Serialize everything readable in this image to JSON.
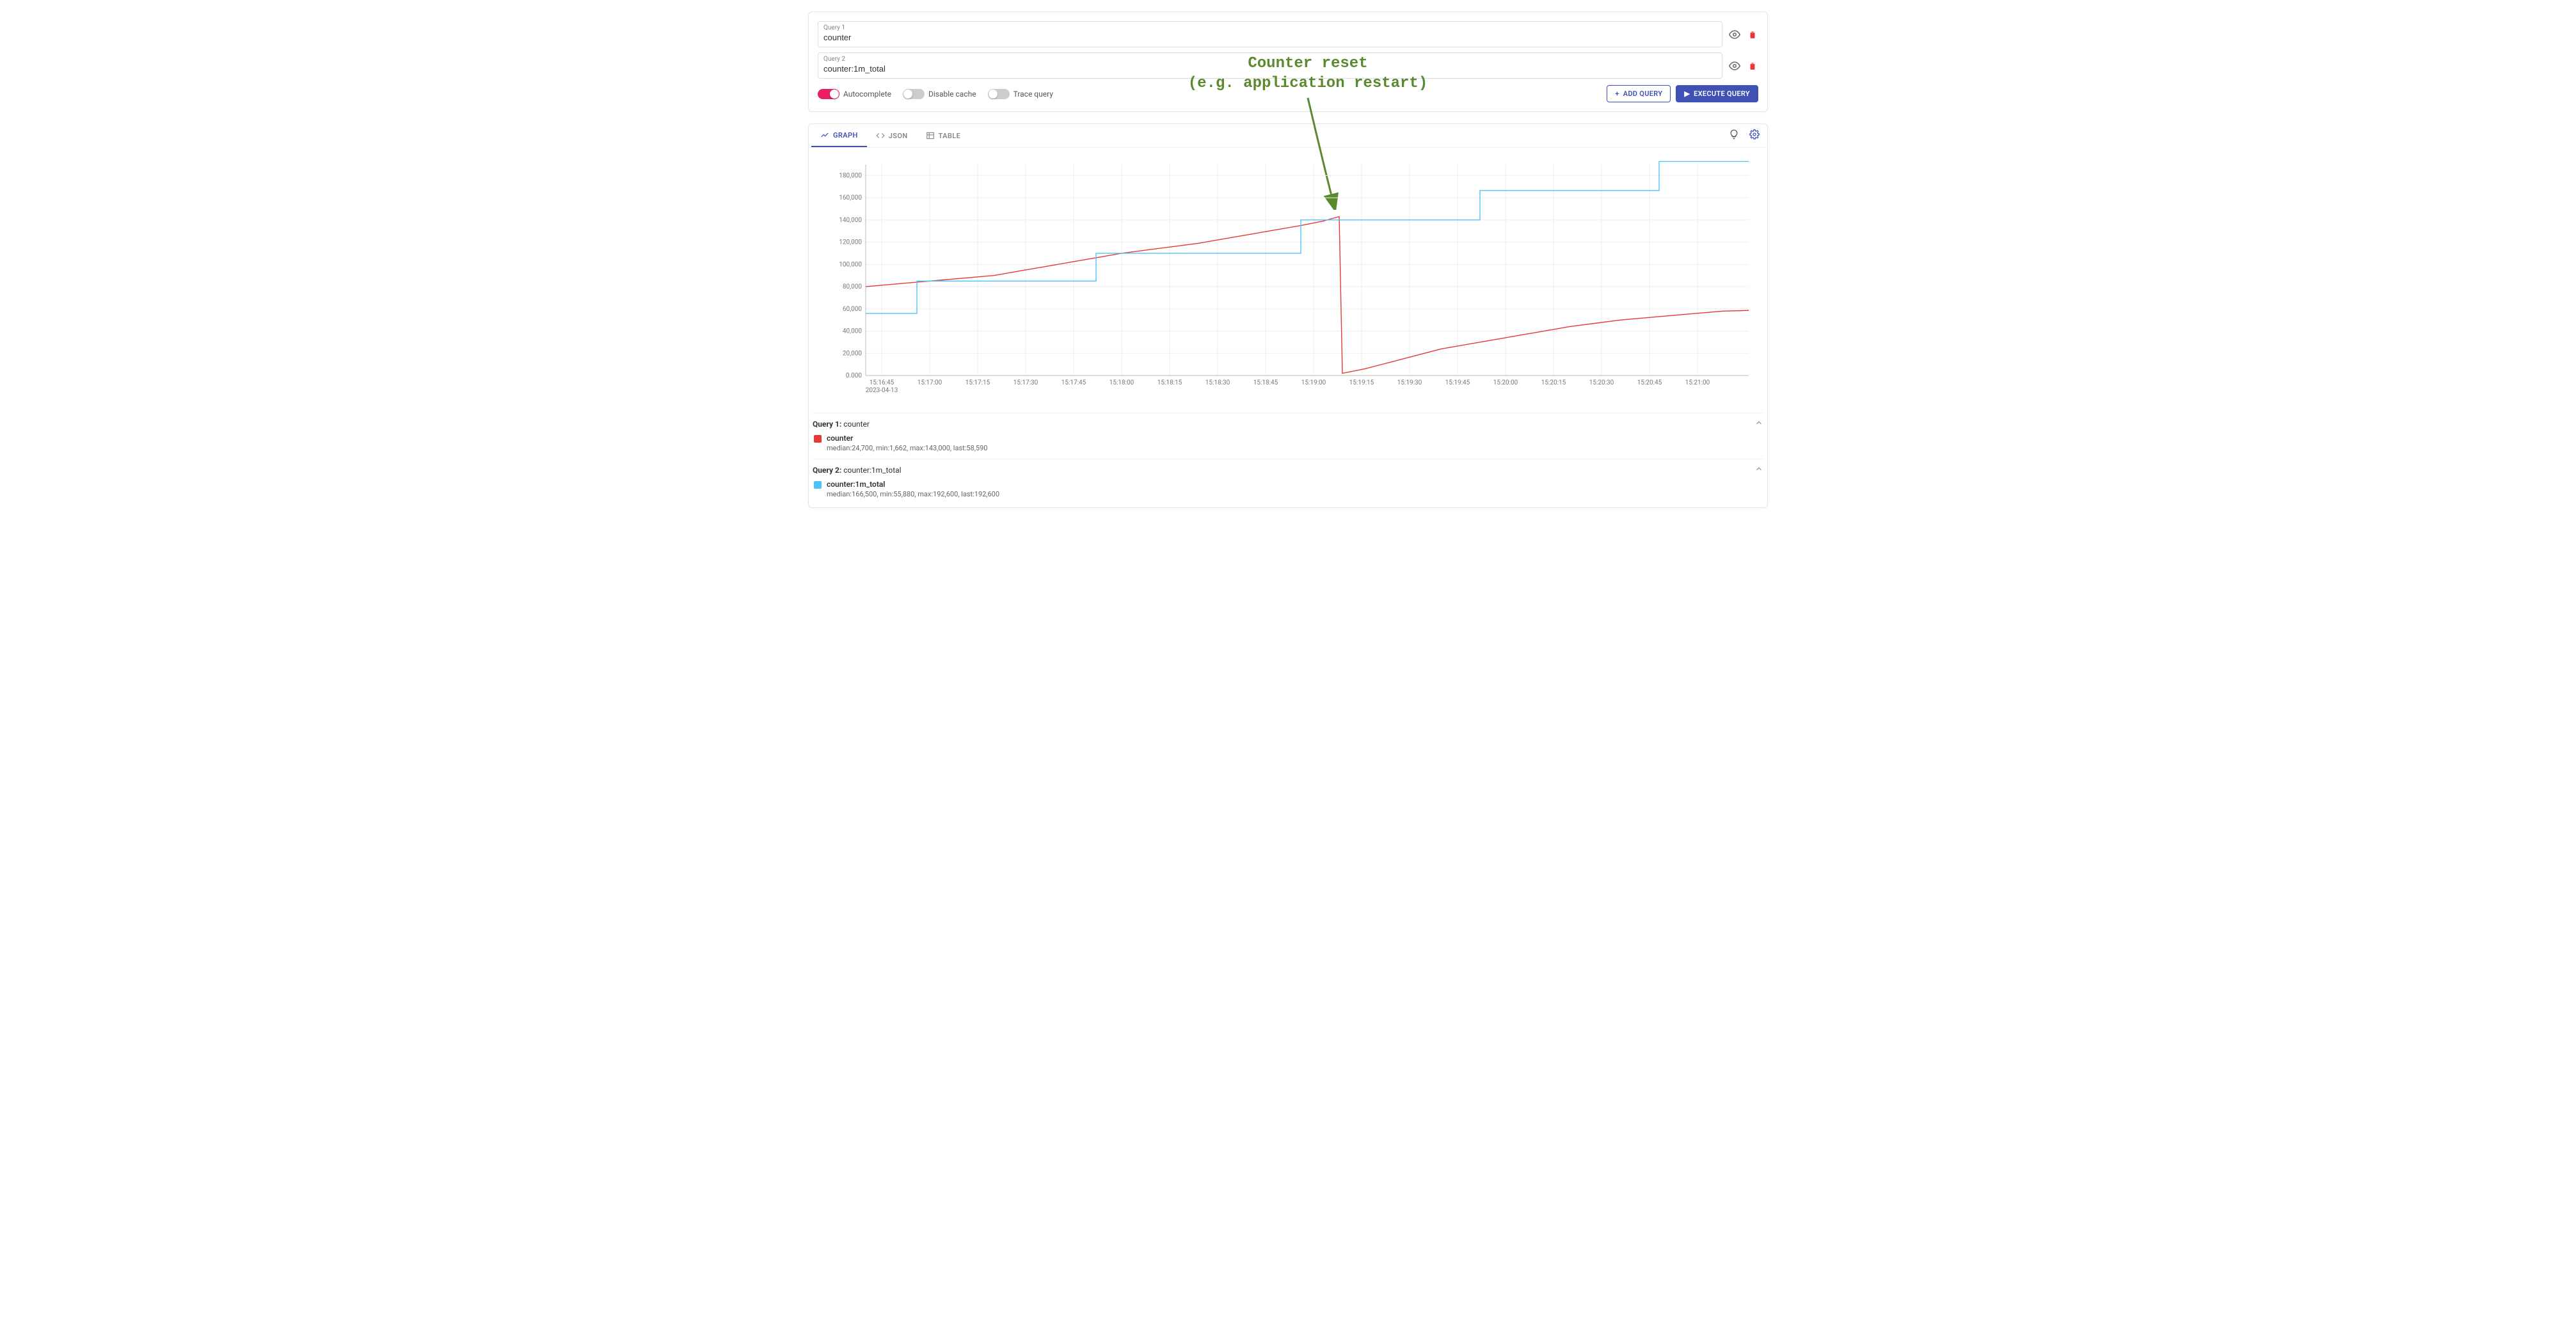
{
  "queries": [
    {
      "label": "Query 1",
      "value": "counter"
    },
    {
      "label": "Query 2",
      "value": "counter:1m_total"
    }
  ],
  "toggles": {
    "autocomplete": {
      "label": "Autocomplete",
      "on": true
    },
    "disable_cache": {
      "label": "Disable cache",
      "on": false
    },
    "trace_query": {
      "label": "Trace query",
      "on": false
    }
  },
  "buttons": {
    "add_query": "ADD QUERY",
    "execute_query": "EXECUTE QUERY"
  },
  "tabs": {
    "graph": "GRAPH",
    "json": "JSON",
    "table": "TABLE",
    "active": "graph"
  },
  "annotation": {
    "line1": "Counter reset",
    "line2": "(e.g. application restart)"
  },
  "legend": [
    {
      "query_label": "Query 1:",
      "query_name": "counter",
      "swatch": "#e53935",
      "name": "counter",
      "stats": "median:24,700, min:1,662, max:143,000, last:58,590"
    },
    {
      "query_label": "Query 2:",
      "query_name": "counter:1m_total",
      "swatch": "#4fc3f7",
      "name": "counter:1m_total",
      "stats": "median:166,500, min:55,880, max:192,600, last:192,600"
    }
  ],
  "chart_data": {
    "type": "line",
    "title": "",
    "xlabel": "",
    "ylabel": "",
    "ylim": [
      0,
      190000
    ],
    "y_ticks": [
      "0.000",
      "20,000",
      "40,000",
      "60,000",
      "80,000",
      "100,000",
      "120,000",
      "140,000",
      "160,000",
      "180,000"
    ],
    "x_ticks": [
      "15:16:45",
      "15:17:00",
      "15:17:15",
      "15:17:30",
      "15:17:45",
      "15:18:00",
      "15:18:15",
      "15:18:30",
      "15:18:45",
      "15:19:00",
      "15:19:15",
      "15:19:30",
      "15:19:45",
      "15:20:00",
      "15:20:15",
      "15:20:30",
      "15:20:45",
      "15:21:00"
    ],
    "x_date": "2023-04-13",
    "series": [
      {
        "name": "counter",
        "color": "#e53935",
        "points": [
          [
            0,
            80000
          ],
          [
            8,
            82000
          ],
          [
            16,
            84000
          ],
          [
            24,
            86000
          ],
          [
            32,
            88000
          ],
          [
            40,
            90000
          ],
          [
            48,
            94000
          ],
          [
            56,
            98000
          ],
          [
            64,
            102000
          ],
          [
            72,
            106000
          ],
          [
            80,
            110000
          ],
          [
            88,
            113000
          ],
          [
            96,
            116000
          ],
          [
            104,
            119000
          ],
          [
            112,
            123000
          ],
          [
            120,
            127000
          ],
          [
            128,
            131000
          ],
          [
            136,
            135000
          ],
          [
            143,
            139000
          ],
          [
            148,
            143000
          ],
          [
            149,
            2000
          ],
          [
            156,
            6000
          ],
          [
            164,
            12000
          ],
          [
            172,
            18000
          ],
          [
            180,
            24000
          ],
          [
            188,
            28000
          ],
          [
            196,
            32000
          ],
          [
            204,
            36000
          ],
          [
            212,
            40000
          ],
          [
            220,
            44000
          ],
          [
            228,
            47000
          ],
          [
            236,
            50000
          ],
          [
            244,
            52000
          ],
          [
            252,
            54000
          ],
          [
            260,
            56000
          ],
          [
            268,
            58000
          ],
          [
            276,
            58590
          ]
        ]
      },
      {
        "name": "counter:1m_total",
        "color": "#4fc3f7",
        "points": [
          [
            0,
            55880
          ],
          [
            16,
            55880
          ],
          [
            16,
            85000
          ],
          [
            72,
            85000
          ],
          [
            72,
            110000
          ],
          [
            136,
            110000
          ],
          [
            136,
            140000
          ],
          [
            192,
            140000
          ],
          [
            192,
            166500
          ],
          [
            248,
            166500
          ],
          [
            248,
            192600
          ],
          [
            276,
            192600
          ]
        ]
      }
    ]
  }
}
